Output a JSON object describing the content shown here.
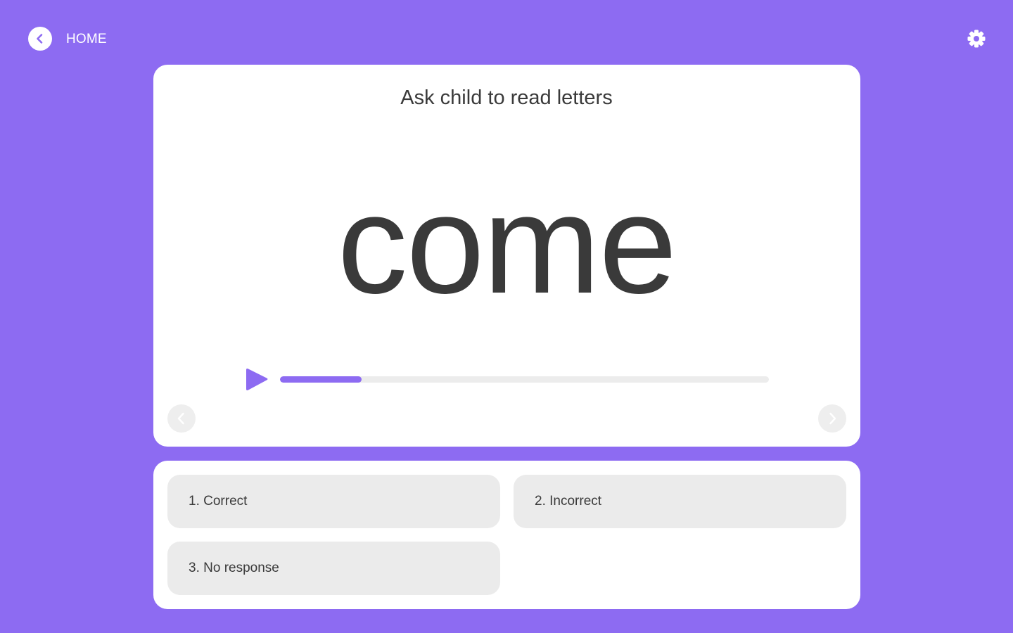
{
  "header": {
    "back_icon": "chevron-left-icon",
    "home_label": "HOME",
    "settings_icon": "gear-icon"
  },
  "card": {
    "instruction": "Ask child to read letters",
    "word": "come",
    "audio": {
      "play_icon": "play-icon",
      "progress": 0.167
    },
    "prev_icon": "chevron-left-icon",
    "next_icon": "chevron-right-icon"
  },
  "answers": [
    {
      "label": "1. Correct"
    },
    {
      "label": "2. Incorrect"
    },
    {
      "label": "3. No response"
    }
  ],
  "colors": {
    "background": "#8D6BF2",
    "accent": "#8D6BF2",
    "card": "#ffffff",
    "text": "#3a3a3a",
    "button": "#ebebeb"
  }
}
